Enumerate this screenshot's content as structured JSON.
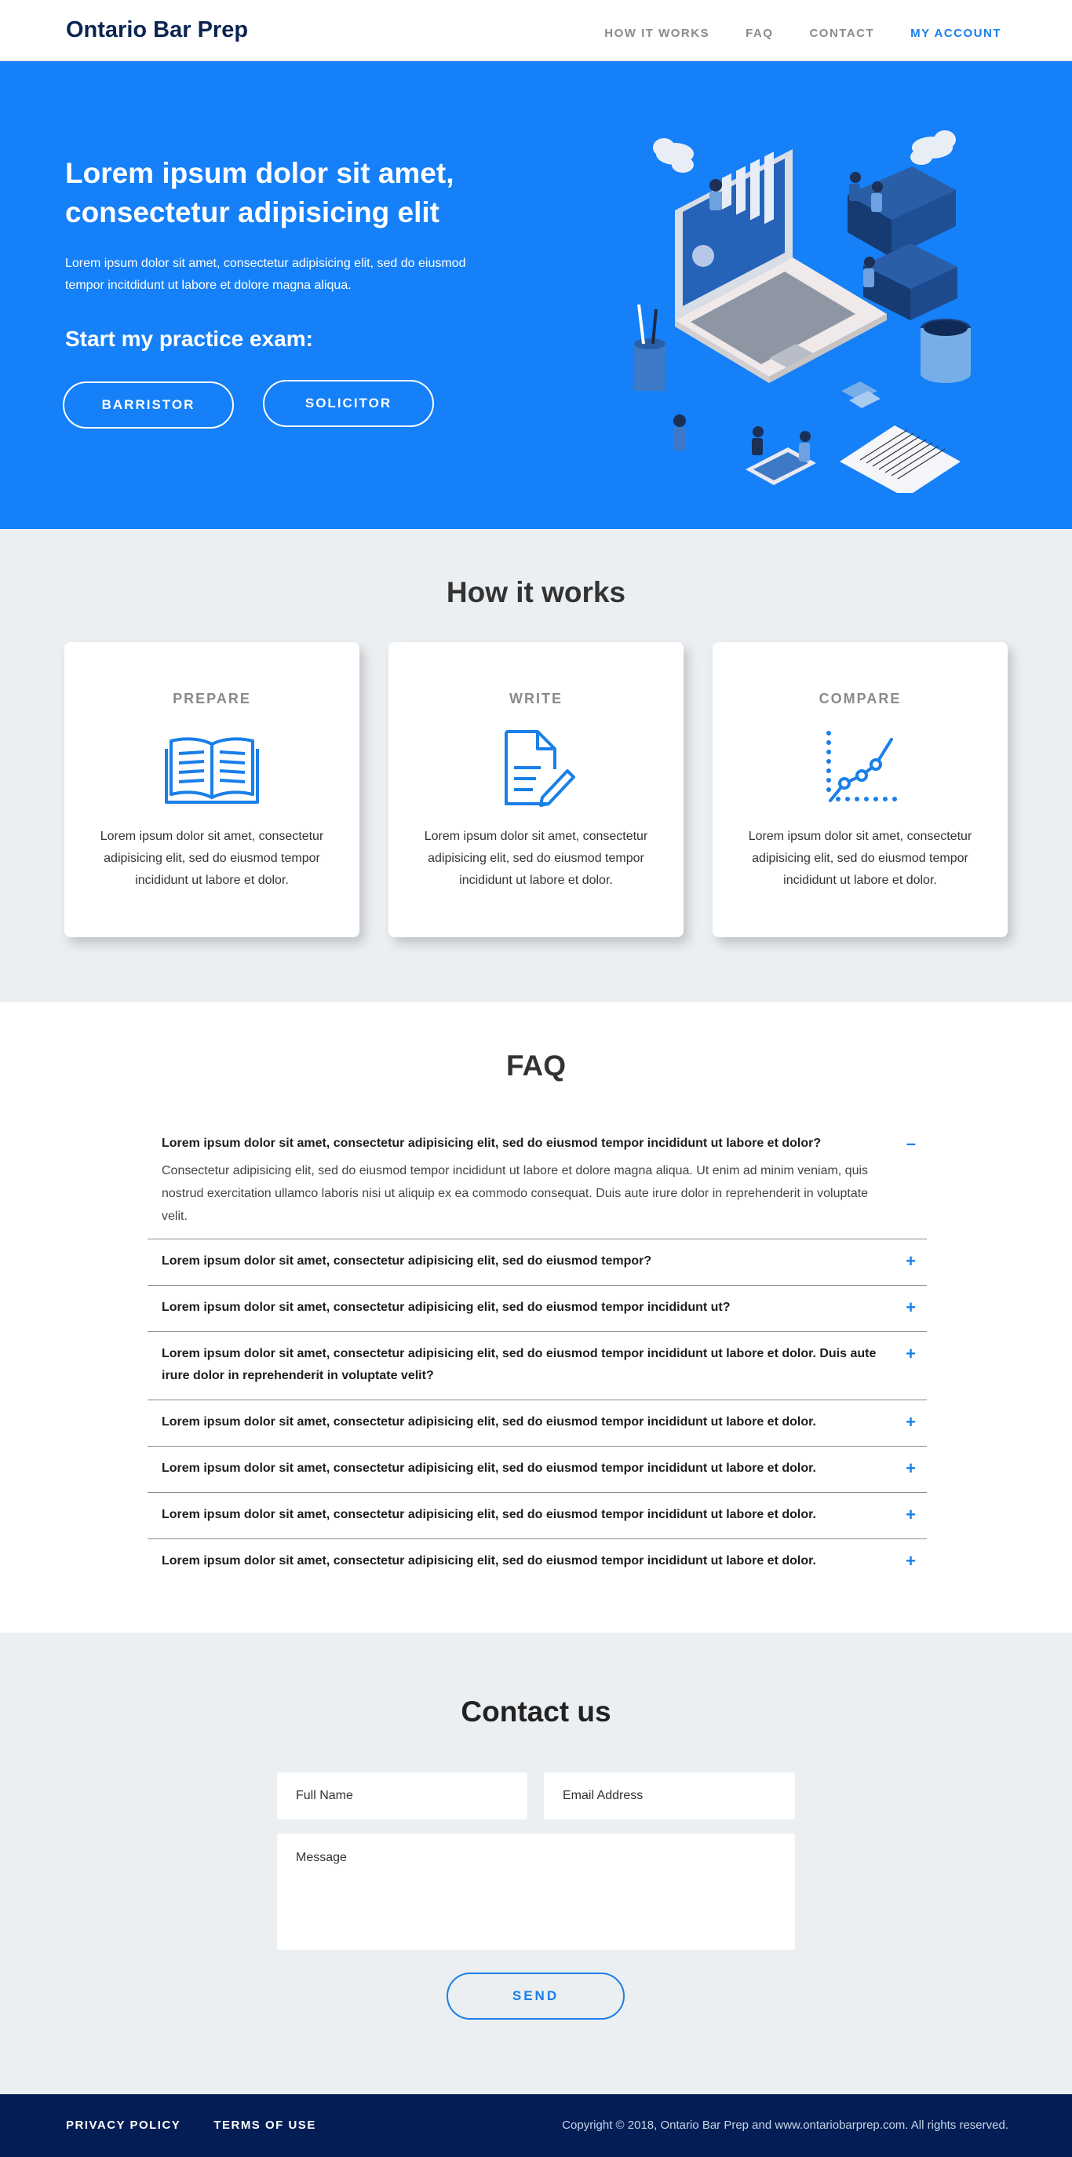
{
  "nav": {
    "brand": "Ontario Bar Prep",
    "items": [
      {
        "label": "HOW IT WORKS"
      },
      {
        "label": "FAQ"
      },
      {
        "label": "CONTACT"
      },
      {
        "label": "MY ACCOUNT",
        "active": true
      }
    ]
  },
  "hero": {
    "title": "Lorem ipsum dolor sit amet, consectetur adipisicing elit",
    "lead": "Lorem ipsum dolor sit amet, consectetur adipisicing elit, sed do eiusmod tempor incitdidunt ut labore et dolore magna aliqua.",
    "cta_heading": "Start my practice exam:",
    "buttons": [
      "BARRISTOR",
      "SOLICITOR"
    ],
    "illustration_icon": "laptop-books-people-illustration"
  },
  "how": {
    "title": "How it works",
    "cards": [
      {
        "title": "PREPARE",
        "icon": "open-book-icon",
        "text": "Lorem ipsum dolor sit amet, consectetur adipisicing elit, sed do eiusmod tempor incididunt ut labore et dolor."
      },
      {
        "title": "WRITE",
        "icon": "document-pencil-icon",
        "text": "Lorem ipsum dolor sit amet, consectetur adipisicing elit, sed do eiusmod tempor incididunt ut labore et dolor."
      },
      {
        "title": "COMPARE",
        "icon": "line-chart-icon",
        "text": "Lorem ipsum dolor sit amet, consectetur adipisicing elit, sed do eiusmod tempor incididunt ut labore et dolor."
      }
    ]
  },
  "faq": {
    "title": "FAQ",
    "items": [
      {
        "q": "Lorem ipsum dolor sit amet, consectetur adipisicing elit, sed do eiusmod tempor incididunt ut labore et dolor?",
        "a": "Consectetur adipisicing elit, sed do eiusmod tempor incididunt ut labore et dolore magna aliqua. Ut enim ad minim veniam, quis nostrud exercitation ullamco laboris nisi ut aliquip ex ea commodo consequat. Duis aute irure dolor in reprehenderit in voluptate velit.",
        "toggle": "–"
      },
      {
        "q": "Lorem ipsum dolor sit amet, consectetur adipisicing elit, sed do eiusmod tempor?",
        "toggle": "+"
      },
      {
        "q": "Lorem ipsum dolor sit amet, consectetur adipisicing elit, sed do eiusmod tempor incididunt ut?",
        "toggle": "+"
      },
      {
        "q": "Lorem ipsum dolor sit amet, consectetur adipisicing elit, sed do eiusmod tempor incididunt ut labore et dolor. Duis aute irure dolor in reprehenderit in voluptate velit?",
        "toggle": "+"
      },
      {
        "q": "Lorem ipsum dolor sit amet, consectetur adipisicing elit, sed do eiusmod tempor incididunt ut labore et dolor.",
        "toggle": "+"
      },
      {
        "q": "Lorem ipsum dolor sit amet, consectetur adipisicing elit, sed do eiusmod tempor incididunt ut labore et dolor.",
        "toggle": "+"
      },
      {
        "q": "Lorem ipsum dolor sit amet, consectetur adipisicing elit, sed do eiusmod tempor incididunt ut labore et dolor.",
        "toggle": "+"
      },
      {
        "q": "Lorem ipsum dolor sit amet, consectetur adipisicing elit, sed do eiusmod tempor incididunt ut labore et dolor.",
        "toggle": "+"
      }
    ]
  },
  "contact": {
    "title": "Contact us",
    "name_placeholder": "Full Name",
    "email_placeholder": "Email Address",
    "message_placeholder": "Message",
    "send_label": "SEND"
  },
  "footer": {
    "links": [
      "PRIVACY POLICY",
      "TERMS OF USE"
    ],
    "copyright": "Copyright © 2018, Ontario Bar Prep and www.ontariobarprep.com. All rights reserved."
  },
  "colors": {
    "hero_bg": "#1580f8",
    "accent": "#1a7fe8",
    "brand_navy": "#0b2452",
    "footer_bg": "#041e55",
    "section_bg": "#ebeff2"
  }
}
